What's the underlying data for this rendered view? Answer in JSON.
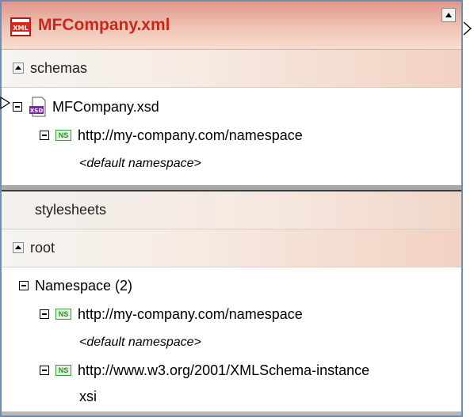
{
  "window": {
    "title": "MFCompany.xml",
    "file_icon": "xml-file-icon"
  },
  "schemas": {
    "header": "schemas",
    "file": {
      "label": "MFCompany.xsd",
      "icon": "xsd-file-icon"
    },
    "namespace": {
      "uri": "http://my-company.com/namespace",
      "prefix_label": "<default namespace>",
      "badge": "NS"
    }
  },
  "stylesheets": {
    "header": "stylesheets"
  },
  "root": {
    "header": "root",
    "namespace_group": "Namespace (2)",
    "namespaces": [
      {
        "uri": "http://my-company.com/namespace",
        "prefix_label": "<default namespace>",
        "badge": "NS"
      },
      {
        "uri": "http://www.w3.org/2001/XMLSchema-instance",
        "prefix_label": "xsi",
        "badge": "NS"
      }
    ]
  },
  "colors": {
    "title_text": "#c8281c",
    "border": "#6e8fb3",
    "ns_badge": "#3a9b3a"
  }
}
